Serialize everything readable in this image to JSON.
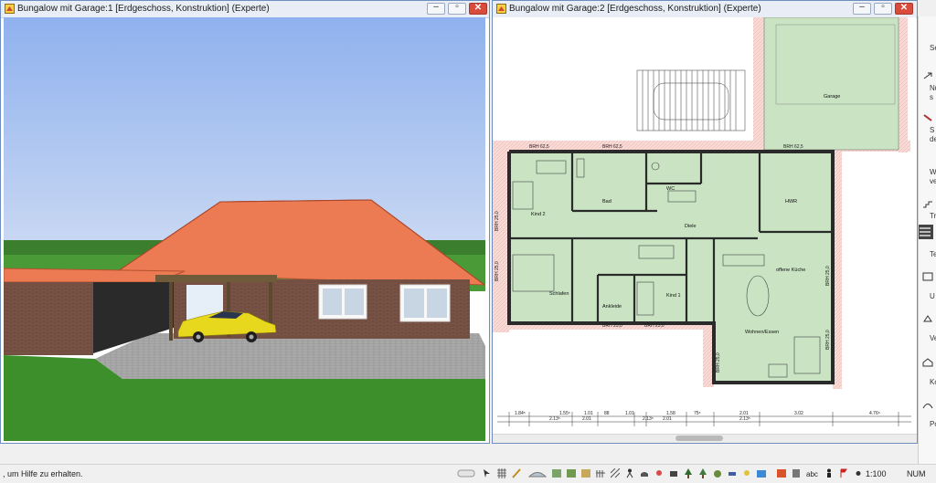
{
  "window_left": {
    "title": "Bungalow mit Garage:1 [Erdgeschoss, Konstruktion] (Experte)",
    "minimize_icon": "minimize-icon",
    "maximize_icon": "maximize-icon",
    "close_icon": "close-icon"
  },
  "window_right": {
    "title": "Bungalow mit Garage:2 [Erdgeschoss, Konstruktion] (Experte)"
  },
  "window_controls": {
    "minimize": "–",
    "maximize": "▫",
    "close": "✕"
  },
  "plan": {
    "rooms": {
      "garage": "Garage",
      "kind2": "Kind 2",
      "bad": "Bad",
      "wc": "WC",
      "hwr": "HWR",
      "diele": "Diele",
      "offene_kueche": "offene Küche",
      "schlafen": "Schlafen",
      "ankleide": "Ankleide",
      "kind1": "Kind 1",
      "wohnen_essen": "Wohnen/Essen"
    },
    "brh_labels": [
      "BRH 62,5",
      "BRH 62,5",
      "BRH 62,5",
      "BRH 25,0",
      "BRH 25,0",
      "BRH 25,0",
      "BRH 25,0",
      "BRH 25,0",
      "BRH 25,0",
      "BRH 25,0"
    ],
    "dimensions": {
      "top": [
        "1.84⁵",
        "1.55⁵",
        "1.01",
        "88",
        "1.01",
        "1.58",
        "75⁵",
        "2.01",
        "3.02",
        "4.76⁵"
      ],
      "bottom": [
        "2.13⁵",
        "2.01",
        "2.13⁵",
        "2.01",
        "2.13⁵"
      ]
    }
  },
  "side_panel": {
    "labels": [
      "Se",
      "Nu",
      "s",
      "S",
      "de",
      "W",
      "ve",
      "Tr",
      "Te",
      "U",
      "Ve",
      "Ko",
      "Po"
    ]
  },
  "status_bar": {
    "hint": ", um Hilfe zu erhalten.",
    "scale": "1:100",
    "num": "NUM"
  },
  "colors": {
    "sky_top": "#8fb1ee",
    "roof": "#ec7a52",
    "brick": "#7a5446",
    "grass": "#3d8f2c",
    "room_fill": "#c9e3c3",
    "hatch": "#f4c9c4",
    "close_button": "#d94b3b"
  }
}
